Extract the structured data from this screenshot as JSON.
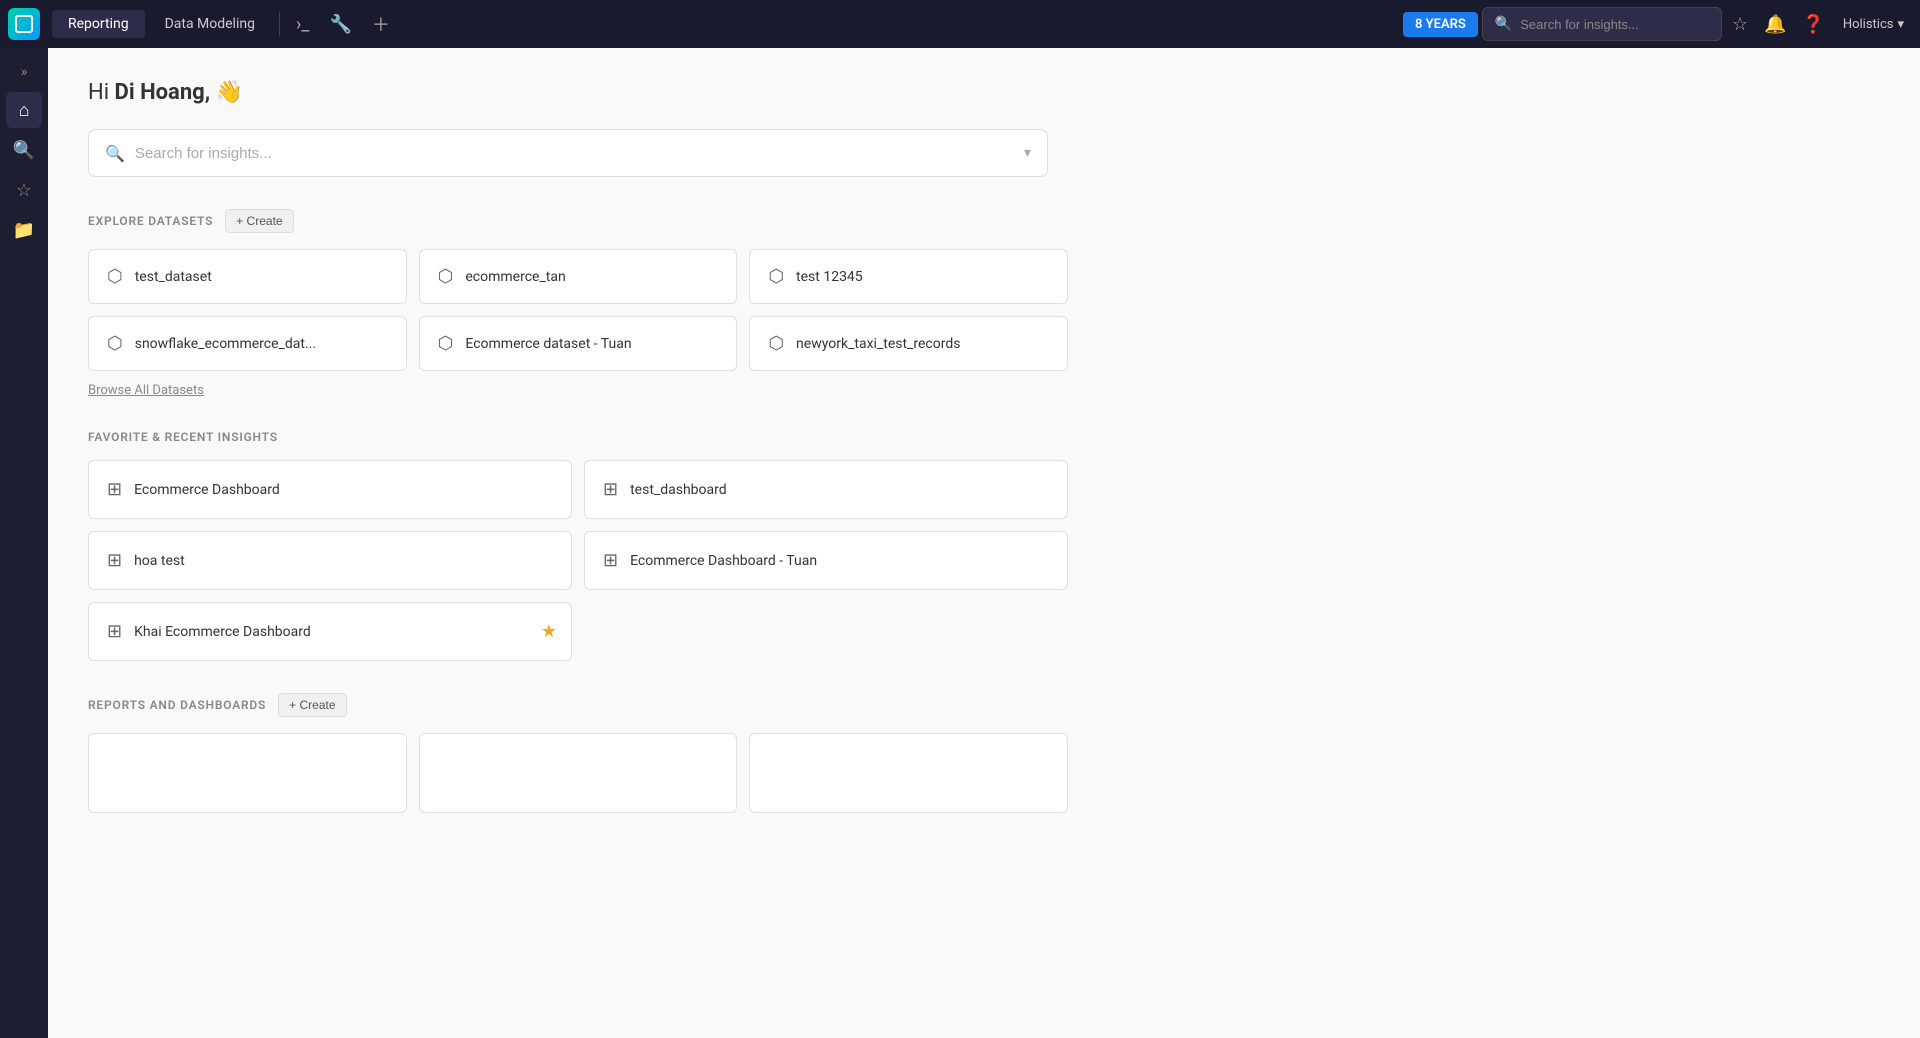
{
  "topNav": {
    "tabs": [
      {
        "id": "reporting",
        "label": "Reporting",
        "active": true
      },
      {
        "id": "data-modeling",
        "label": "Data Modeling",
        "active": false
      }
    ],
    "badge": "8 YEARS",
    "searchPlaceholder": "Search for insights...",
    "userName": "Holistics"
  },
  "sidebar": {
    "expandTitle": "Expand sidebar",
    "items": [
      {
        "id": "home",
        "icon": "⌂",
        "label": "Home",
        "active": true
      },
      {
        "id": "search",
        "icon": "🔍",
        "label": "Search"
      },
      {
        "id": "favorites",
        "icon": "☆",
        "label": "Favorites"
      },
      {
        "id": "collections",
        "icon": "📁",
        "label": "Collections"
      }
    ]
  },
  "main": {
    "greeting": "Hi",
    "userName": "Di Hoang,",
    "greetingEmoji": "👋",
    "mainSearchPlaceholder": "Search for insights...",
    "exploreDatasetsTitle": "EXPLORE DATASETS",
    "createDatasetLabel": "+ Create",
    "datasets": [
      {
        "id": 1,
        "name": "test_dataset"
      },
      {
        "id": 2,
        "name": "ecommerce_tan"
      },
      {
        "id": 3,
        "name": "test 12345"
      },
      {
        "id": 4,
        "name": "snowflake_ecommerce_dat..."
      },
      {
        "id": 5,
        "name": "Ecommerce dataset - Tuan"
      },
      {
        "id": 6,
        "name": "newyork_taxi_test_records"
      }
    ],
    "browseAllLabel": "Browse All Datasets",
    "favRecentTitle": "FAVORITE & RECENT INSIGHTS",
    "insights": [
      {
        "id": 1,
        "name": "Ecommerce Dashboard",
        "starred": false
      },
      {
        "id": 2,
        "name": "test_dashboard",
        "starred": false
      },
      {
        "id": 3,
        "name": "hoa test",
        "starred": false
      },
      {
        "id": 4,
        "name": "Ecommerce Dashboard - Tuan",
        "starred": false
      },
      {
        "id": 5,
        "name": "Khai Ecommerce Dashboard",
        "starred": true
      }
    ],
    "reportsDashboardsTitle": "REPORTS AND DASHBOARDS",
    "createReportLabel": "+ Create",
    "reports": [
      {
        "id": 1
      },
      {
        "id": 2
      },
      {
        "id": 3
      }
    ]
  }
}
